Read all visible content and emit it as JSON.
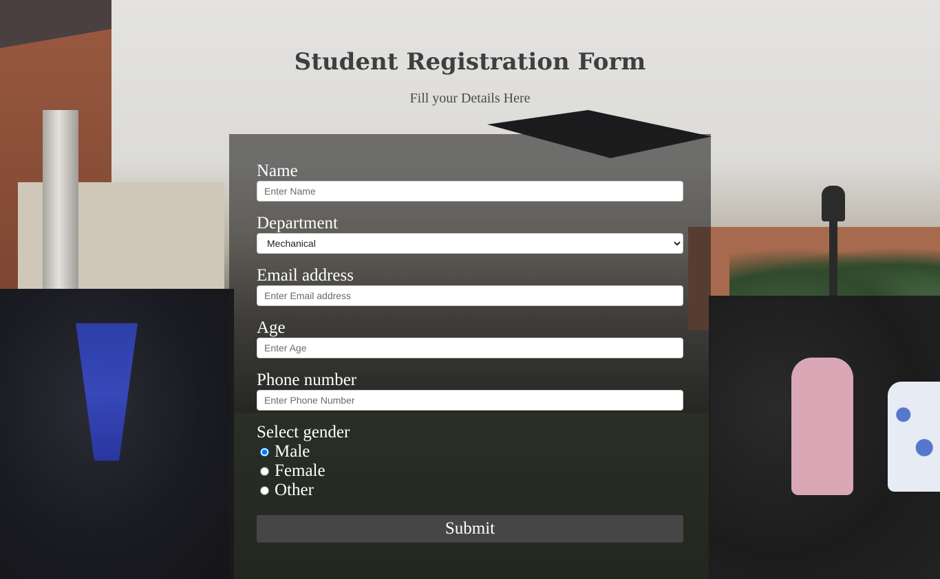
{
  "header": {
    "title": "Student Registration Form",
    "subtitle": "Fill your Details Here"
  },
  "form": {
    "name": {
      "label": "Name",
      "placeholder": "Enter Name",
      "value": ""
    },
    "department": {
      "label": "Department",
      "selected": "Mechanical"
    },
    "email": {
      "label": "Email address",
      "placeholder": "Enter Email address",
      "value": ""
    },
    "age": {
      "label": "Age",
      "placeholder": "Enter Age",
      "value": ""
    },
    "phone": {
      "label": "Phone number",
      "placeholder": "Enter Phone Number",
      "value": ""
    },
    "gender": {
      "label": "Select gender",
      "options": [
        "Male",
        "Female",
        "Other"
      ],
      "selected": "Male"
    },
    "submit_label": "Submit"
  },
  "colors": {
    "title": "#3f3f3f",
    "panel": "rgba(30,30,30,0.58)",
    "submit_bg": "#464646",
    "label_text": "#ffffff"
  }
}
